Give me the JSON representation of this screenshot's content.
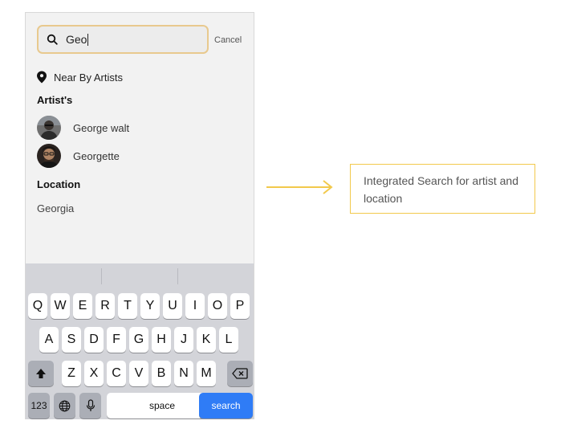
{
  "search": {
    "query": "Geo",
    "cancel_label": "Cancel"
  },
  "nearby": {
    "label": "Near By Artists"
  },
  "artists": {
    "header": "Artist's",
    "items": [
      {
        "name": "George walt"
      },
      {
        "name": "Georgette"
      }
    ]
  },
  "location": {
    "header": "Location",
    "items": [
      "Georgia"
    ]
  },
  "keyboard": {
    "row1": [
      "Q",
      "W",
      "E",
      "R",
      "T",
      "Y",
      "U",
      "I",
      "O",
      "P"
    ],
    "row2": [
      "A",
      "S",
      "D",
      "F",
      "G",
      "H",
      "J",
      "K",
      "L"
    ],
    "row3": [
      "Z",
      "X",
      "C",
      "V",
      "B",
      "N",
      "M"
    ],
    "numbers_label": "123",
    "space_label": "space",
    "search_label": "search"
  },
  "annotation": {
    "text": "Integrated Search for artist and location"
  },
  "colors": {
    "accent": "#f2c94c",
    "search_border": "#e8c98e",
    "key_blue": "#2f7cf6"
  }
}
